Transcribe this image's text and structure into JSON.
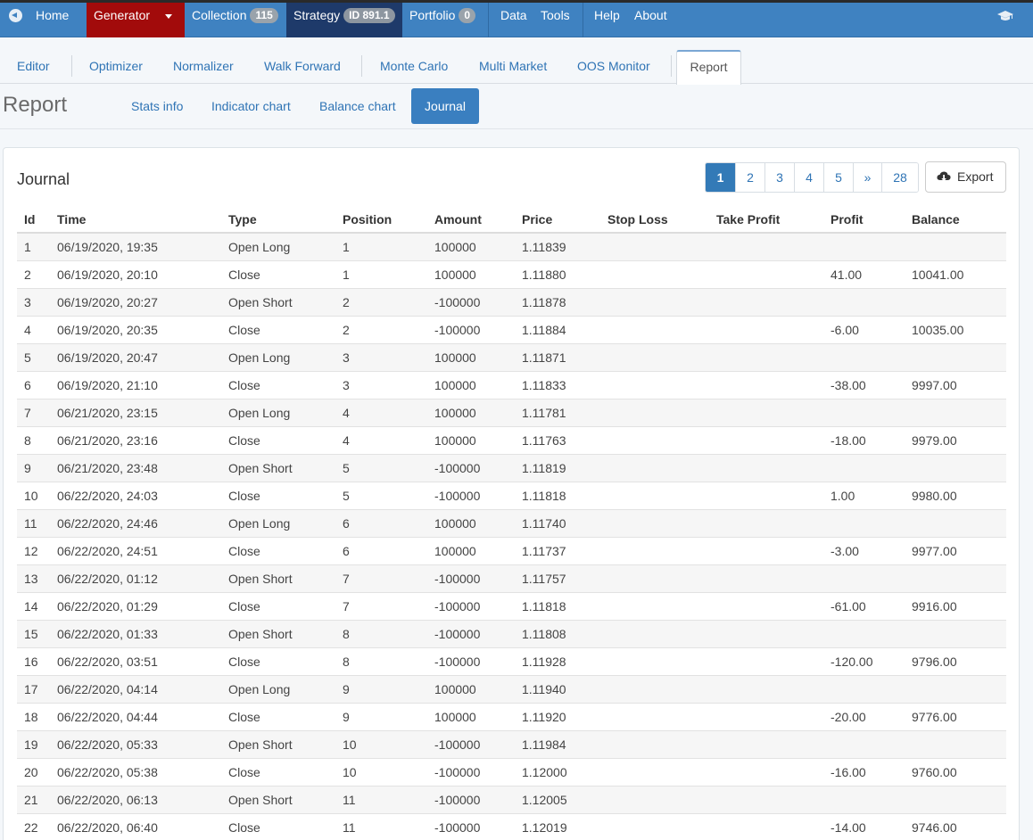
{
  "topnav": {
    "home": "Home",
    "generator": "Generator",
    "collection": "Collection",
    "collection_count": "115",
    "strategy": "Strategy",
    "strategy_id": "ID 891.1",
    "portfolio": "Portfolio",
    "portfolio_count": "0",
    "data": "Data",
    "tools": "Tools",
    "help": "Help",
    "about": "About"
  },
  "subtabs": {
    "editor": "Editor",
    "optimizer": "Optimizer",
    "normalizer": "Normalizer",
    "walk_forward": "Walk Forward",
    "monte_carlo": "Monte Carlo",
    "multi_market": "Multi Market",
    "oos_monitor": "OOS Monitor",
    "report": "Report"
  },
  "report": {
    "title": "Report",
    "pills": {
      "stats_info": "Stats info",
      "indicator_chart": "Indicator chart",
      "balance_chart": "Balance chart",
      "journal": "Journal"
    }
  },
  "journal": {
    "title": "Journal",
    "pager": [
      "1",
      "2",
      "3",
      "4",
      "5",
      "»",
      "28"
    ],
    "export": "Export",
    "columns": [
      "Id",
      "Time",
      "Type",
      "Position",
      "Amount",
      "Price",
      "Stop Loss",
      "Take Profit",
      "Profit",
      "Balance"
    ],
    "rows": [
      [
        "1",
        "06/19/2020, 19:35",
        "Open Long",
        "1",
        "100000",
        "1.11839",
        "",
        "",
        "",
        ""
      ],
      [
        "2",
        "06/19/2020, 20:10",
        "Close",
        "1",
        "100000",
        "1.11880",
        "",
        "",
        "41.00",
        "10041.00"
      ],
      [
        "3",
        "06/19/2020, 20:27",
        "Open Short",
        "2",
        "-100000",
        "1.11878",
        "",
        "",
        "",
        ""
      ],
      [
        "4",
        "06/19/2020, 20:35",
        "Close",
        "2",
        "-100000",
        "1.11884",
        "",
        "",
        "-6.00",
        "10035.00"
      ],
      [
        "5",
        "06/19/2020, 20:47",
        "Open Long",
        "3",
        "100000",
        "1.11871",
        "",
        "",
        "",
        ""
      ],
      [
        "6",
        "06/19/2020, 21:10",
        "Close",
        "3",
        "100000",
        "1.11833",
        "",
        "",
        "-38.00",
        "9997.00"
      ],
      [
        "7",
        "06/21/2020, 23:15",
        "Open Long",
        "4",
        "100000",
        "1.11781",
        "",
        "",
        "",
        ""
      ],
      [
        "8",
        "06/21/2020, 23:16",
        "Close",
        "4",
        "100000",
        "1.11763",
        "",
        "",
        "-18.00",
        "9979.00"
      ],
      [
        "9",
        "06/21/2020, 23:48",
        "Open Short",
        "5",
        "-100000",
        "1.11819",
        "",
        "",
        "",
        ""
      ],
      [
        "10",
        "06/22/2020, 24:03",
        "Close",
        "5",
        "-100000",
        "1.11818",
        "",
        "",
        "1.00",
        "9980.00"
      ],
      [
        "11",
        "06/22/2020, 24:46",
        "Open Long",
        "6",
        "100000",
        "1.11740",
        "",
        "",
        "",
        ""
      ],
      [
        "12",
        "06/22/2020, 24:51",
        "Close",
        "6",
        "100000",
        "1.11737",
        "",
        "",
        "-3.00",
        "9977.00"
      ],
      [
        "13",
        "06/22/2020, 01:12",
        "Open Short",
        "7",
        "-100000",
        "1.11757",
        "",
        "",
        "",
        ""
      ],
      [
        "14",
        "06/22/2020, 01:29",
        "Close",
        "7",
        "-100000",
        "1.11818",
        "",
        "",
        "-61.00",
        "9916.00"
      ],
      [
        "15",
        "06/22/2020, 01:33",
        "Open Short",
        "8",
        "-100000",
        "1.11808",
        "",
        "",
        "",
        ""
      ],
      [
        "16",
        "06/22/2020, 03:51",
        "Close",
        "8",
        "-100000",
        "1.11928",
        "",
        "",
        "-120.00",
        "9796.00"
      ],
      [
        "17",
        "06/22/2020, 04:14",
        "Open Long",
        "9",
        "100000",
        "1.11940",
        "",
        "",
        "",
        ""
      ],
      [
        "18",
        "06/22/2020, 04:44",
        "Close",
        "9",
        "100000",
        "1.11920",
        "",
        "",
        "-20.00",
        "9776.00"
      ],
      [
        "19",
        "06/22/2020, 05:33",
        "Open Short",
        "10",
        "-100000",
        "1.11984",
        "",
        "",
        "",
        ""
      ],
      [
        "20",
        "06/22/2020, 05:38",
        "Close",
        "10",
        "-100000",
        "1.12000",
        "",
        "",
        "-16.00",
        "9760.00"
      ],
      [
        "21",
        "06/22/2020, 06:13",
        "Open Short",
        "11",
        "-100000",
        "1.12005",
        "",
        "",
        "",
        ""
      ],
      [
        "22",
        "06/22/2020, 06:40",
        "Close",
        "11",
        "-100000",
        "1.12019",
        "",
        "",
        "-14.00",
        "9746.00"
      ]
    ]
  },
  "icons": {
    "home": "circle-arrow-left-icon",
    "generator_caret": "caret-down-icon",
    "graduation": "graduation-cap-icon",
    "export": "cloud-download-icon"
  },
  "colors": {
    "navbar": "#3f82c1",
    "generator_active": "#a20b0b",
    "strategy_active": "#1e3a6a",
    "link": "#2f74b5",
    "primary": "#337ab7"
  }
}
